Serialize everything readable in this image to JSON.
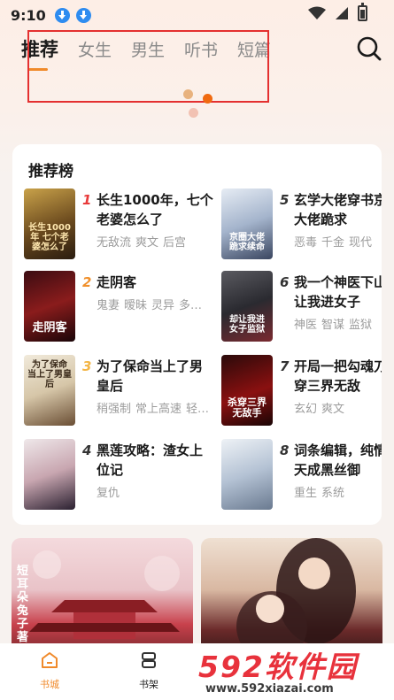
{
  "status": {
    "time": "9:10"
  },
  "tabs": [
    {
      "label": "推荐",
      "active": true
    },
    {
      "label": "女生",
      "active": false
    },
    {
      "label": "男生",
      "active": false
    },
    {
      "label": "听书",
      "active": false
    },
    {
      "label": "短篇",
      "active": false
    }
  ],
  "ranking": {
    "title": "推荐榜",
    "books": [
      {
        "rank": "1",
        "title": "长生1000年，七个老婆怎么了",
        "tags": [
          "无敌流",
          "爽文",
          "后宫"
        ],
        "cover_text": "长生1000年 七个老婆怎么了",
        "rank_color": "#e83a3a"
      },
      {
        "rank": "2",
        "title": "走阴客",
        "tags": [
          "鬼妻",
          "暧昧",
          "灵异",
          "多…"
        ],
        "cover_text": "走阴客",
        "rank_color": "#f0902c"
      },
      {
        "rank": "3",
        "title": "为了保命当上了男皇后",
        "tags": [
          "稍强制",
          "常上高速",
          "轻…"
        ],
        "cover_text": "为了保命 当上了男皇后",
        "rank_color": "#f3b545"
      },
      {
        "rank": "4",
        "title": "黑莲攻略：渣女上位记",
        "tags": [
          "复仇"
        ],
        "cover_text": "",
        "rank_color": "#333333"
      },
      {
        "rank": "5",
        "title": "玄学大佬穿书京圈大佬跪求",
        "tags": [
          "恶毒",
          "千金",
          "现代"
        ],
        "cover_text": "京圈大佬 跪求续命",
        "rank_color": "#333333"
      },
      {
        "rank": "6",
        "title": "我一个神医下山却让我进女子",
        "tags": [
          "神医",
          "智谋",
          "监狱"
        ],
        "cover_text": "却让我进 女子监狱",
        "rank_color": "#333333"
      },
      {
        "rank": "7",
        "title": "开局一把勾魂刀杀穿三界无敌",
        "tags": [
          "玄幻",
          "爽文"
        ],
        "cover_text": "杀穿三界 无敌手",
        "rank_color": "#333333"
      },
      {
        "rank": "8",
        "title": "词条编辑，纯情三天成黑丝御",
        "tags": [
          "重生",
          "系统"
        ],
        "cover_text": "",
        "rank_color": "#333333"
      }
    ]
  },
  "promos": [
    {
      "text": "短耳朵兔子著"
    },
    {
      "text": ""
    }
  ],
  "nav": [
    {
      "label": "书城",
      "active": true
    },
    {
      "label": "书架",
      "active": false
    }
  ],
  "watermark": {
    "big": "592软件园",
    "small": "www.592xiazai.com"
  },
  "colors": {
    "accent": "#f08a2b",
    "annotation_box": "#e43030",
    "download_badge": "#2e8cf0"
  }
}
